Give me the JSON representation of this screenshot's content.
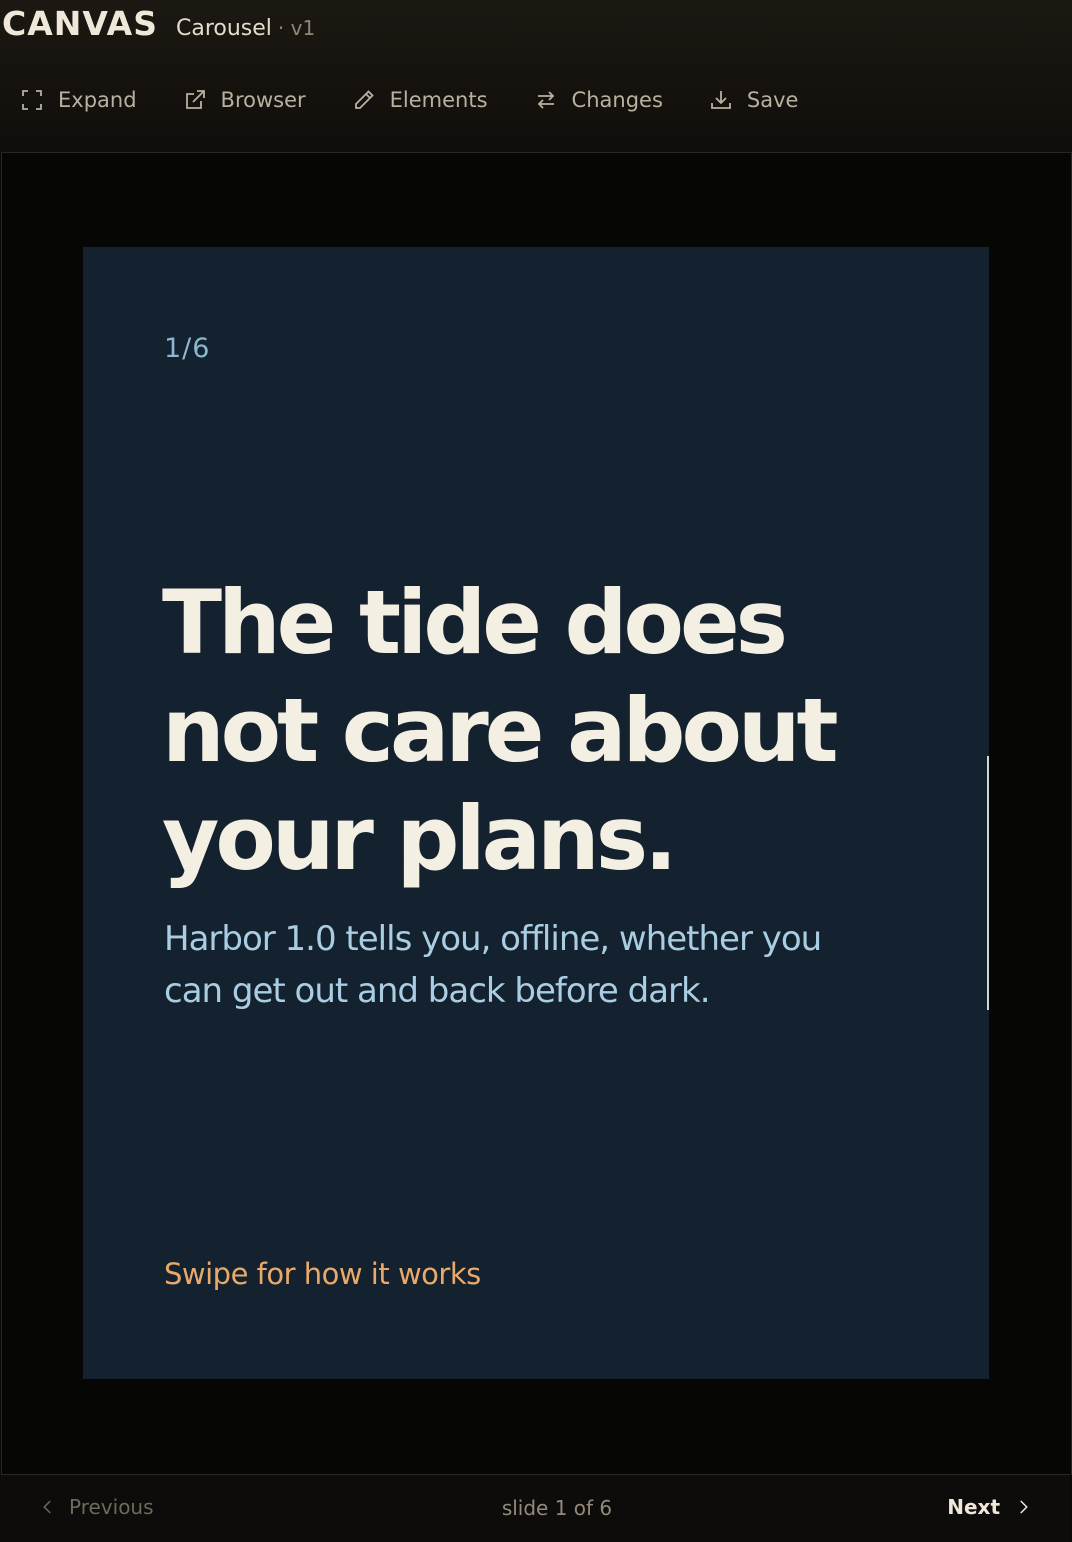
{
  "app": {
    "brand": "CANVAS",
    "document_name": "Carousel",
    "version": "· v1"
  },
  "toolbar": [
    {
      "label": "Expand",
      "icon": "expand-icon"
    },
    {
      "label": "Browser",
      "icon": "external-link-icon"
    },
    {
      "label": "Elements",
      "icon": "pencil-icon"
    },
    {
      "label": "Changes",
      "icon": "swap-arrows-icon"
    },
    {
      "label": "Save",
      "icon": "download-icon"
    }
  ],
  "slide": {
    "counter": "1/6",
    "headline": "The tide does not care about your plans.",
    "subhead": "Harbor 1.0 tells you, offline, whether you can get out and back before dark.",
    "cta": "Swipe for how it works"
  },
  "footer": {
    "previous_label": "Previous",
    "status": "slide 1 of 6",
    "next_label": "Next"
  },
  "colors": {
    "slide_background": "#14212e",
    "headline": "#f4efe3",
    "subhead": "#a9cde3",
    "cta": "#e9a96a",
    "counter": "#8ab6cf"
  }
}
